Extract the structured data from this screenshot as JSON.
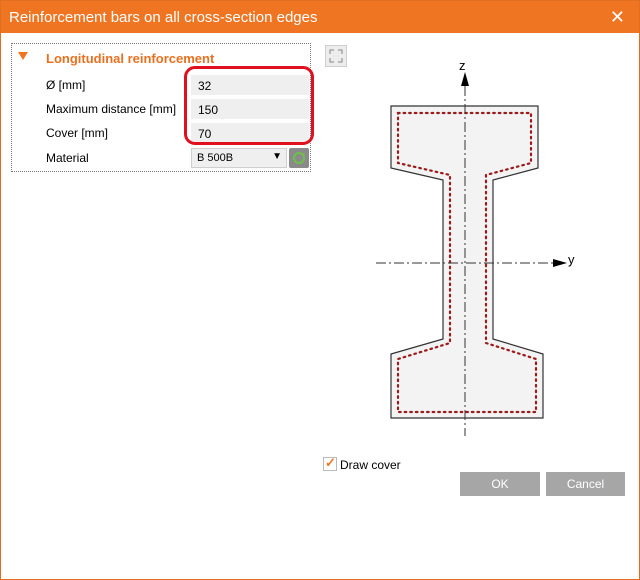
{
  "window": {
    "title": "Reinforcement bars on all cross-section edges",
    "close_icon": "close-icon"
  },
  "panel": {
    "section_title": "Longitudinal reinforcement",
    "rows": [
      {
        "label": "Ø [mm]",
        "value": "32"
      },
      {
        "label": "Maximum distance [mm]",
        "value": "150"
      },
      {
        "label": "Cover [mm]",
        "value": "70"
      }
    ],
    "material": {
      "label": "Material",
      "value": "B 500B"
    }
  },
  "drawing": {
    "axis_z": "z",
    "axis_y": "y"
  },
  "draw_cover": {
    "label": "Draw cover",
    "checked": true
  },
  "buttons": {
    "ok": "OK",
    "cancel": "Cancel"
  },
  "colors": {
    "accent": "#f07522",
    "highlight": "#e0101e",
    "rebar": "#9b1b1b"
  }
}
